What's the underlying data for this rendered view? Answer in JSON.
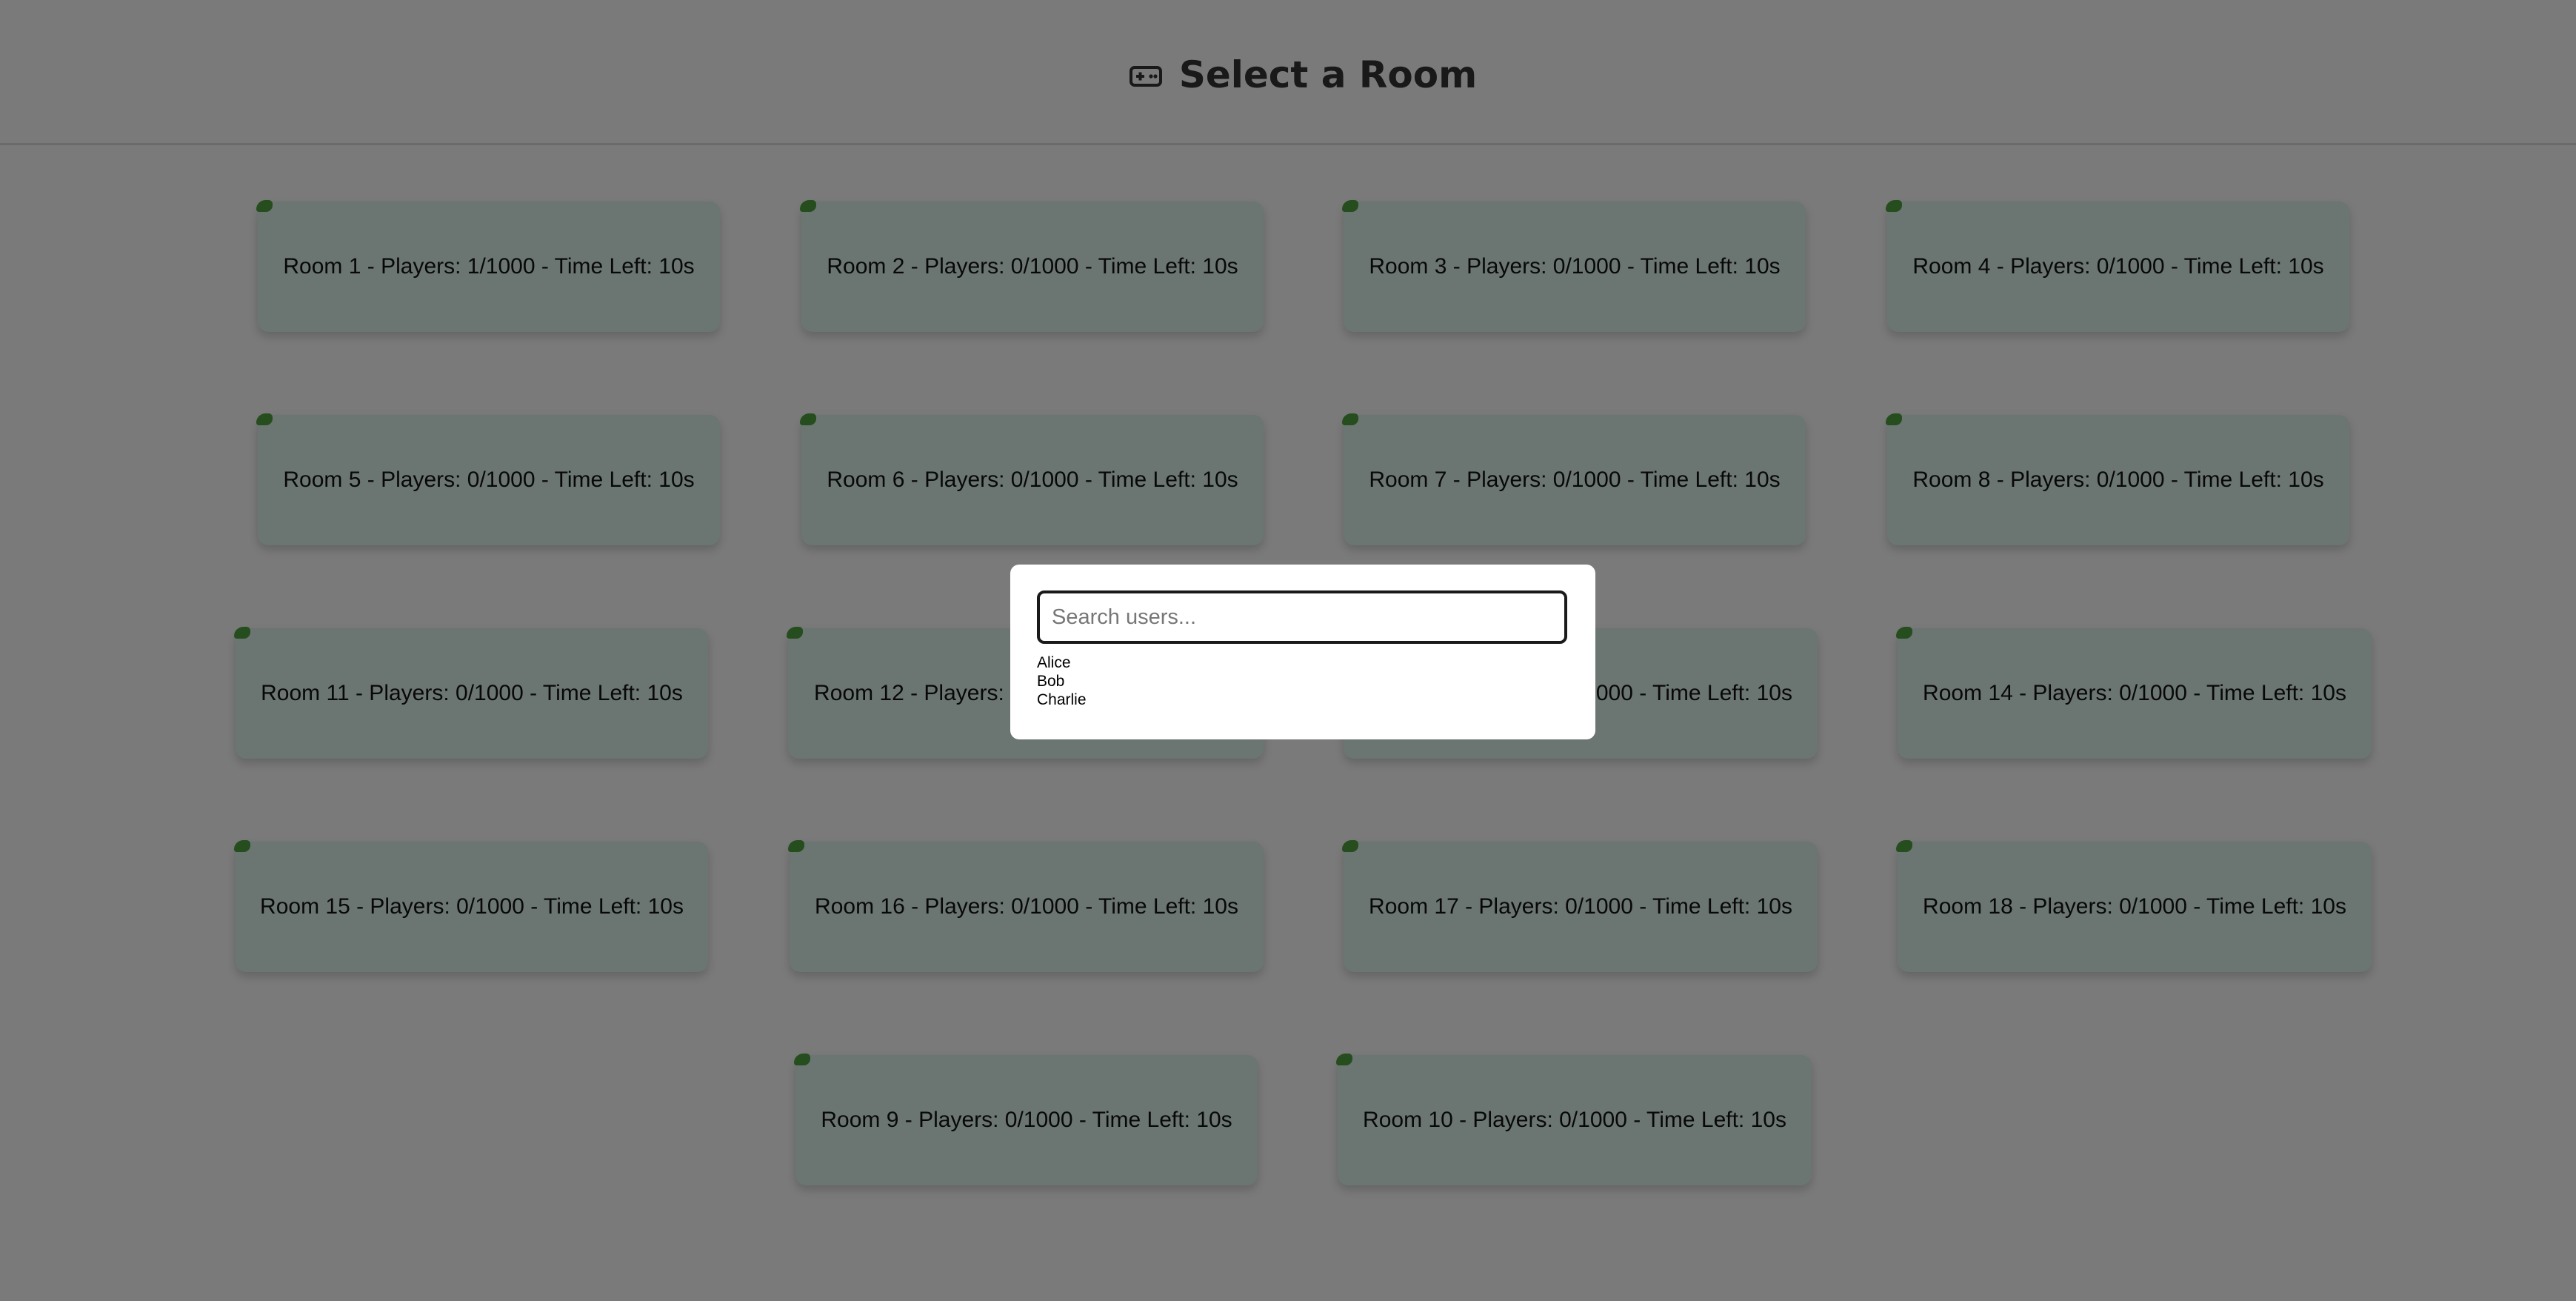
{
  "header": {
    "title": "Select a Room",
    "icon": "gamepad-icon"
  },
  "rooms": [
    {
      "label": "Room 1 - Players: 1/1000 - Time Left: 10s"
    },
    {
      "label": "Room 2 - Players: 0/1000 - Time Left: 10s"
    },
    {
      "label": "Room 3 - Players: 0/1000 - Time Left: 10s"
    },
    {
      "label": "Room 4 - Players: 0/1000 - Time Left: 10s"
    },
    {
      "label": "Room 5 - Players: 0/1000 - Time Left: 10s"
    },
    {
      "label": "Room 6 - Players: 0/1000 - Time Left: 10s"
    },
    {
      "label": "Room 7 - Players: 0/1000 - Time Left: 10s"
    },
    {
      "label": "Room 8 - Players: 0/1000 - Time Left: 10s"
    },
    {
      "label": "Room 11 - Players: 0/1000 - Time Left: 10s"
    },
    {
      "label": "Room 12 - Players: 0/1000 - Time Left: 10s"
    },
    {
      "label": "Room 13 - Players: 0/1000 - Time Left: 10s"
    },
    {
      "label": "Room 14 - Players: 0/1000 - Time Left: 10s"
    },
    {
      "label": "Room 15 - Players: 0/1000 - Time Left: 10s"
    },
    {
      "label": "Room 16 - Players: 0/1000 - Time Left: 10s"
    },
    {
      "label": "Room 17 - Players: 0/1000 - Time Left: 10s"
    },
    {
      "label": "Room 18 - Players: 0/1000 - Time Left: 10s"
    },
    {
      "label": "Room 9 - Players: 0/1000 - Time Left: 10s"
    },
    {
      "label": "Room 10 - Players: 0/1000 - Time Left: 10s"
    }
  ],
  "search_modal": {
    "placeholder": "Search users...",
    "value": "",
    "users": [
      "Alice",
      "Bob",
      "Charlie"
    ]
  },
  "colors": {
    "room_card": "#d7ebe5",
    "status_dot": "#4a9a3a",
    "overlay": "rgba(0,0,0,0.5)"
  }
}
